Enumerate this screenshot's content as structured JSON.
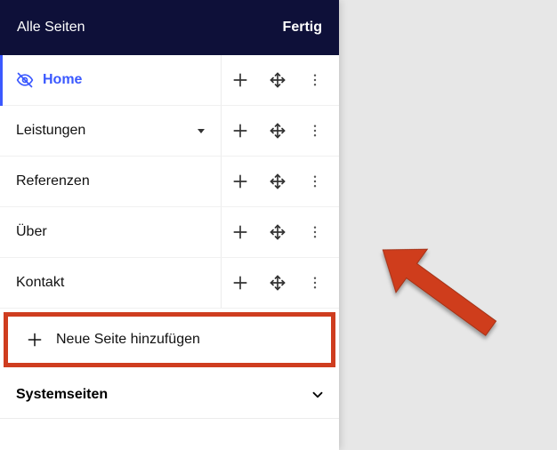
{
  "header": {
    "title": "Alle Seiten",
    "done_label": "Fertig"
  },
  "pages": [
    {
      "name": "Home",
      "hidden_icon": true,
      "active": true,
      "has_children": false
    },
    {
      "name": "Leistungen",
      "hidden_icon": false,
      "active": false,
      "has_children": true
    },
    {
      "name": "Referenzen",
      "hidden_icon": false,
      "active": false,
      "has_children": false
    },
    {
      "name": "Über",
      "hidden_icon": false,
      "active": false,
      "has_children": false
    },
    {
      "name": "Kontakt",
      "hidden_icon": false,
      "active": false,
      "has_children": false
    }
  ],
  "add_page_label": "Neue Seite hinzufügen",
  "system_section_label": "Systemseiten",
  "annotation": {
    "highlight_color": "#cf3d1f"
  },
  "icons": {
    "hidden": "hidden-icon",
    "plus": "plus-icon",
    "move": "move-icon",
    "more": "more-vertical-icon",
    "dropdown": "triangle-down-icon",
    "chevron_down": "chevron-down-icon"
  }
}
